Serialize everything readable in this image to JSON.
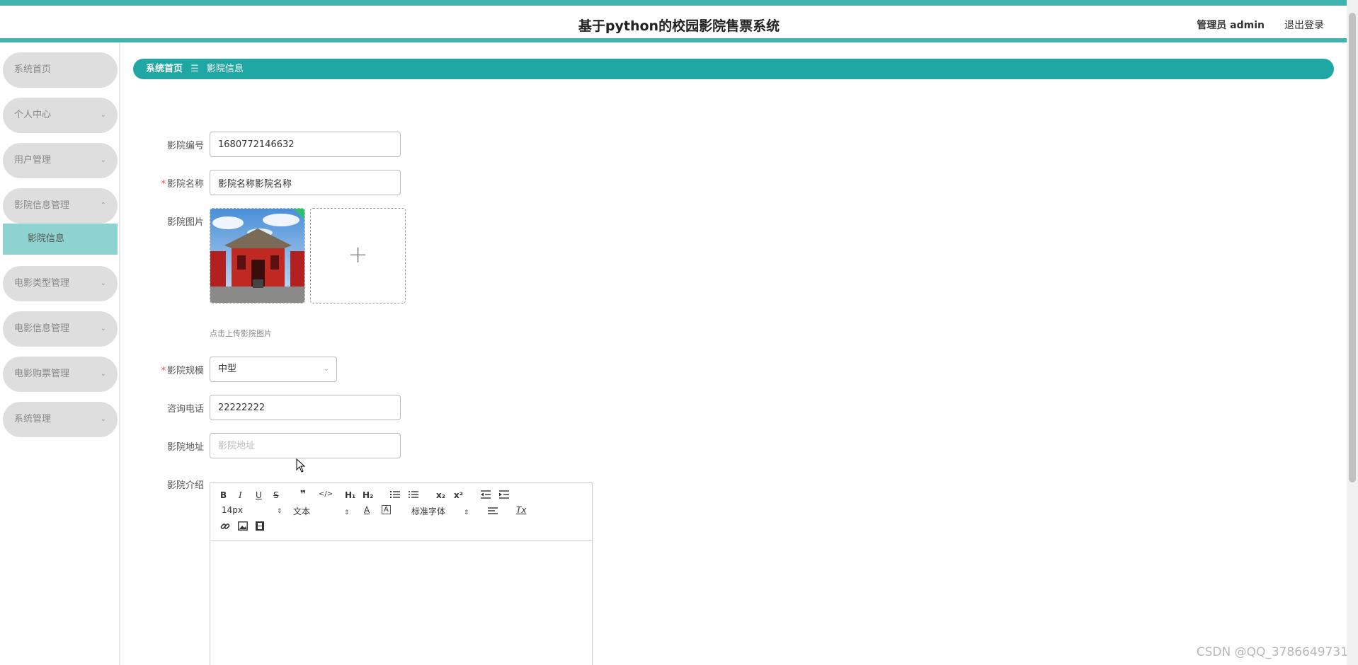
{
  "header": {
    "title": "基于python的校园影院售票系统",
    "user": "管理员 admin",
    "logout": "退出登录"
  },
  "sidebar": {
    "items": [
      {
        "label": "系统首页"
      },
      {
        "label": "个人中心",
        "chevron": "⌄"
      },
      {
        "label": "用户管理",
        "chevron": "⌄"
      },
      {
        "label": "影院信息管理",
        "chevron": "⌃",
        "expanded": true
      },
      {
        "label": "电影类型管理",
        "chevron": "⌄"
      },
      {
        "label": "电影信息管理",
        "chevron": "⌄"
      },
      {
        "label": "电影购票管理",
        "chevron": "⌄"
      },
      {
        "label": "系统管理",
        "chevron": "⌄"
      }
    ],
    "subitem": {
      "label": "影院信息"
    }
  },
  "breadcrumb": {
    "home": "系统首页",
    "separator": "☰",
    "current": "影院信息"
  },
  "form": {
    "cinema_no": {
      "label": "影院编号",
      "value": "1680772146632"
    },
    "cinema_name": {
      "label": "影院名称",
      "value": "影院名称影院名称",
      "required_mark": "*"
    },
    "cinema_image": {
      "label": "影院图片",
      "upload_plus": "+",
      "hint": "点击上传影院图片"
    },
    "cinema_scale": {
      "label": "影院规模",
      "value": "中型",
      "required_mark": "*",
      "chevron": "⌄"
    },
    "phone": {
      "label": "咨询电话",
      "value": "22222222"
    },
    "address": {
      "label": "影院地址",
      "value": "",
      "placeholder": "影院地址"
    },
    "intro": {
      "label": "影院介绍"
    }
  },
  "editor": {
    "toolbar": {
      "bold": "B",
      "italic": "I",
      "underline": "U",
      "strike": "S",
      "blockquote": "❞",
      "code": "</>",
      "h1": "H₁",
      "h2": "H₂",
      "x_sub": "x₂",
      "x_sup": "x²",
      "size": "14px",
      "header": "文本",
      "font_color": "A",
      "font_bg": "A",
      "font": "标准字体",
      "clean": "Tx",
      "select_arrow": "⇕"
    }
  },
  "watermark": "CSDN @QQ_3786649731",
  "colors": {
    "accent": "#1fa8a3",
    "accent_light": "#8fd3d0",
    "menu_bg": "#dedede",
    "required": "#e94d4d"
  }
}
